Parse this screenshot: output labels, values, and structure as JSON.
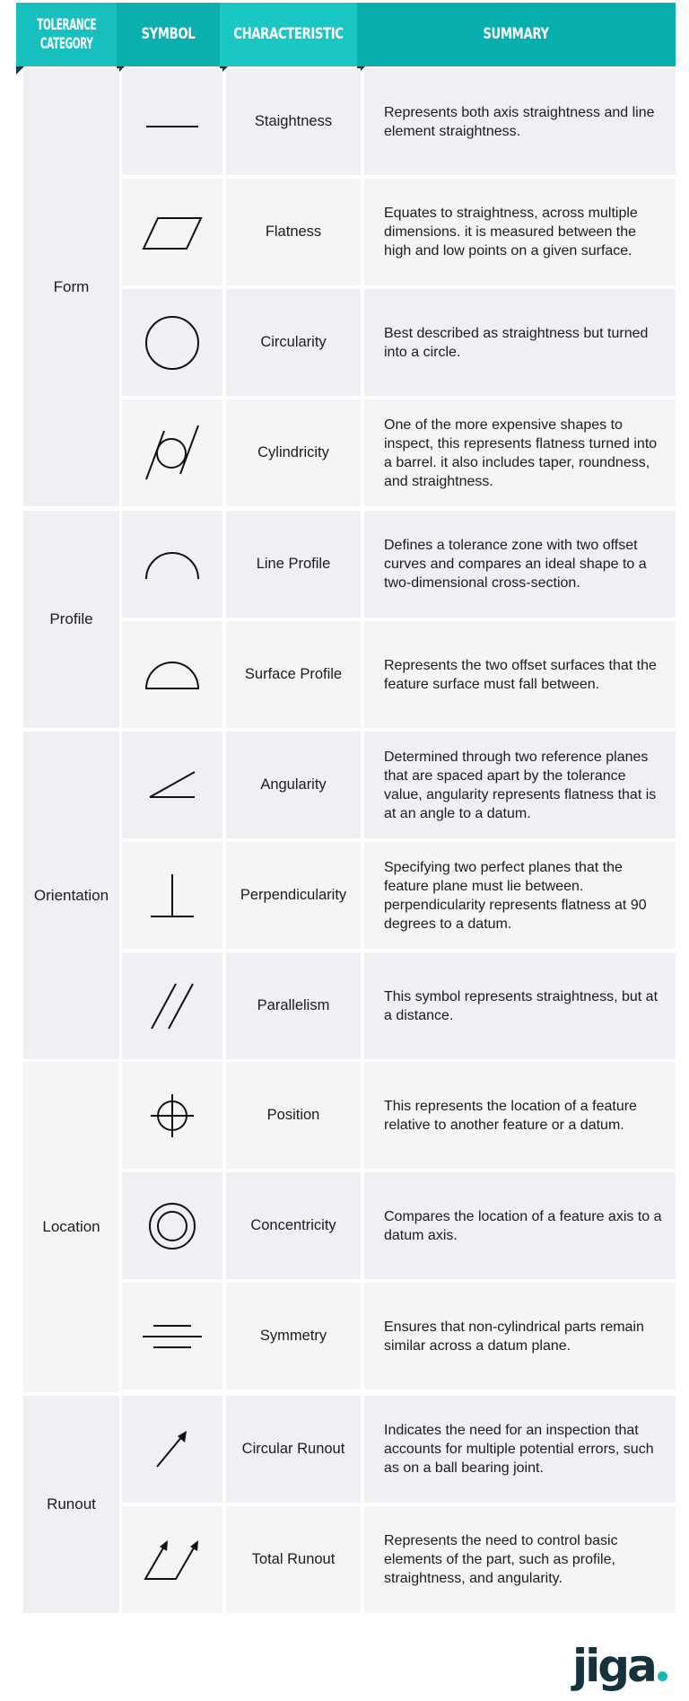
{
  "header": {
    "columns": [
      {
        "label": "TOLERANCE CATEGORY",
        "line1": "TOLERANCE",
        "line2": "CATEGORY",
        "color": "#17c0bf"
      },
      {
        "label": "SYMBOL",
        "color": "#0aafae"
      },
      {
        "label": "CHARACTERISTIC",
        "color": "#1bc7c5"
      },
      {
        "label": "SUMMARY",
        "color": "#06afae"
      }
    ],
    "fold_color": "#123a44"
  },
  "colors": {
    "row_blue": "#eef0f3",
    "row_light": "#f5f5f6",
    "text": "#1c1c1c",
    "logo_text": "#17323d",
    "logo_dot": "#1ab9b8"
  },
  "groups": [
    {
      "category": "Form",
      "rows": [
        {
          "symbol": "straightness-icon",
          "characteristic": "Staightness",
          "summary": "Represents both axis straightness and line element straightness."
        },
        {
          "symbol": "flatness-icon",
          "characteristic": "Flatness",
          "summary": "Equates to straightness, across multiple dimensions. it is measured between the high and low points on a given surface."
        },
        {
          "symbol": "circularity-icon",
          "characteristic": "Circularity",
          "summary": "Best described as straightness but turned into a circle."
        },
        {
          "symbol": "cylindricity-icon",
          "characteristic": "Cylindricity",
          "summary": "One of the more expensive shapes to inspect, this represents flatness turned into a barrel. it also includes taper, roundness, and straightness."
        }
      ]
    },
    {
      "category": "Profile",
      "rows": [
        {
          "symbol": "line-profile-icon",
          "characteristic": "Line Profile",
          "summary": "Defines a tolerance zone with two offset curves and compares an ideal shape to a two-dimensional cross-section."
        },
        {
          "symbol": "surface-profile-icon",
          "characteristic": "Surface Profile",
          "summary": "Represents the two offset surfaces that the feature surface must fall between."
        }
      ]
    },
    {
      "category": "Orientation",
      "rows": [
        {
          "symbol": "angularity-icon",
          "characteristic": "Angularity",
          "summary": "Determined through two reference planes that are spaced apart by the tolerance value, angularity represents flatness that is at an angle to a datum."
        },
        {
          "symbol": "perpendicularity-icon",
          "characteristic": "Perpendicularity",
          "summary": "Specifying two perfect planes that the feature plane must lie between. perpendicularity represents flatness at 90 degrees to a datum."
        },
        {
          "symbol": "parallelism-icon",
          "characteristic": "Parallelism",
          "summary": "This symbol represents straightness, but at a distance."
        }
      ]
    },
    {
      "category": "Location",
      "rows": [
        {
          "symbol": "position-icon",
          "characteristic": "Position",
          "summary": "This represents the location of a feature relative to another feature or a datum."
        },
        {
          "symbol": "concentricity-icon",
          "characteristic": "Concentricity",
          "summary": "Compares the location of a feature axis to a datum axis."
        },
        {
          "symbol": "symmetry-icon",
          "characteristic": "Symmetry",
          "summary": "Ensures that non-cylindrical parts remain similar across a datum plane."
        }
      ]
    },
    {
      "category": "Runout",
      "rows": [
        {
          "symbol": "circular-runout-icon",
          "characteristic": "Circular Runout",
          "summary": "Indicates the need for an inspection that accounts for multiple potential errors, such as on a ball bearing joint."
        },
        {
          "symbol": "total-runout-icon",
          "characteristic": "Total Runout",
          "summary": "Represents the need to control basic elements of the part, such as profile, straightness, and angularity."
        }
      ]
    }
  ],
  "logo": {
    "text": "jiga"
  }
}
